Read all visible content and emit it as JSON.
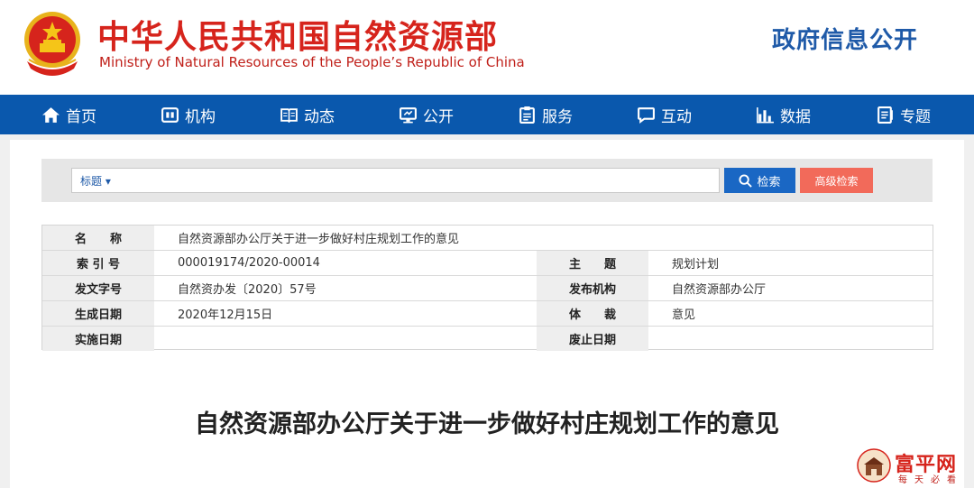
{
  "header": {
    "title_cn": "中华人民共和国自然资源部",
    "title_en": "Ministry of Natural Resources of the People’s Republic of China",
    "gov_info": "政府信息公开"
  },
  "nav": {
    "items": [
      {
        "label": "首页",
        "icon": "home-icon"
      },
      {
        "label": "机构",
        "icon": "org-icon"
      },
      {
        "label": "动态",
        "icon": "book-icon"
      },
      {
        "label": "公开",
        "icon": "monitor-icon"
      },
      {
        "label": "服务",
        "icon": "clipboard-icon"
      },
      {
        "label": "互动",
        "icon": "chat-icon"
      },
      {
        "label": "数据",
        "icon": "chart-icon"
      },
      {
        "label": "专题",
        "icon": "album-icon"
      }
    ]
  },
  "search": {
    "type_label": "标题 ▾",
    "value": "",
    "search_label": "检索",
    "advanced_label": "高级检索"
  },
  "info": {
    "name_label": "名　　称",
    "name_value": "自然资源部办公厅关于进一步做好村庄规划工作的意见",
    "index_label": "索 引 号",
    "index_value": "000019174/2020-00014",
    "topic_label": "主　　题",
    "topic_value": "规划计划",
    "doc_no_label": "发文字号",
    "doc_no_value": "自然资办发〔2020〕57号",
    "issuer_label": "发布机构",
    "issuer_value": "自然资源部办公厅",
    "date_label": "生成日期",
    "date_value": "2020年12月15日",
    "genre_label": "体　　裁",
    "genre_value": "意见",
    "effective_label": "实施日期",
    "effective_value": "",
    "expire_label": "废止日期",
    "expire_value": ""
  },
  "article": {
    "title": "自然资源部办公厅关于进一步做好村庄规划工作的意见"
  },
  "watermark": {
    "brand": "富平网",
    "tagline": "每天必看"
  },
  "colors": {
    "brand_red": "#d6241c",
    "nav_blue": "#0a58ad",
    "search_blue": "#1a67c4",
    "advanced_red": "#f26a5a"
  }
}
